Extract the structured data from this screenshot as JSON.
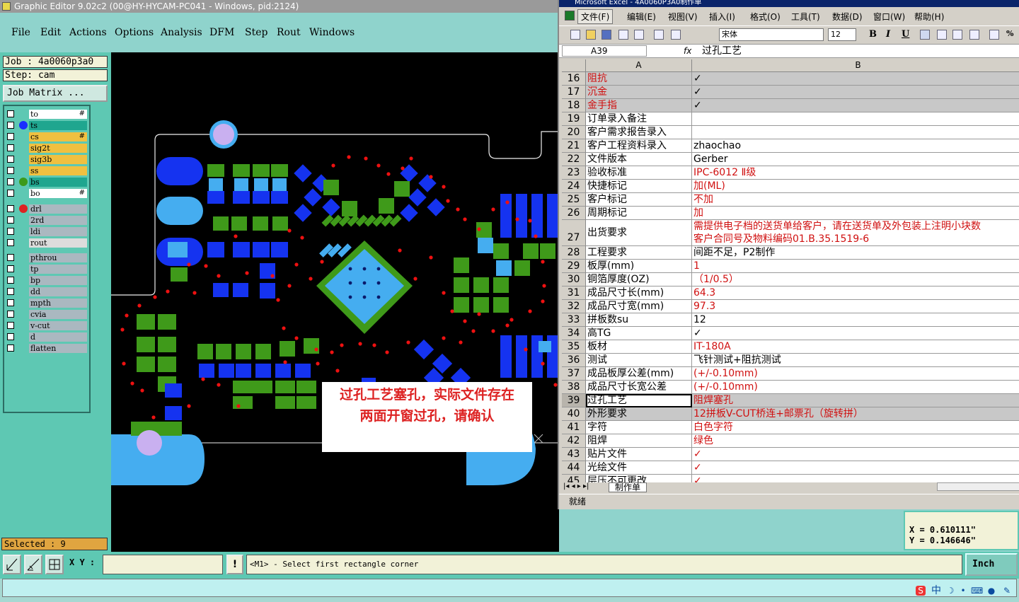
{
  "genesis": {
    "title": "Graphic Editor 9.02c2 (00@HY-HYCAM-PC041 - Windows, pid:2124)",
    "menu": [
      "File",
      "Edit",
      "Actions",
      "Options",
      "Analysis",
      "DFM",
      "Step",
      "Rout",
      "Windows"
    ],
    "job": "Job : 4a0060p3a0",
    "step": "Step: cam",
    "job_matrix": "Job Matrix ...",
    "layers": [
      {
        "name": "to",
        "color": "#ffffff",
        "dot": "",
        "mark": "#"
      },
      {
        "name": "ts",
        "color": "#1fa68f",
        "dot": "#1a2cff",
        "mark": ""
      },
      {
        "name": "cs",
        "color": "#f0c040",
        "dot": "",
        "mark": "#"
      },
      {
        "name": "sig2t",
        "color": "#f0c040",
        "dot": "",
        "mark": ""
      },
      {
        "name": "sig3b",
        "color": "#f0c040",
        "dot": "",
        "mark": ""
      },
      {
        "name": "ss",
        "color": "#f0c040",
        "dot": "",
        "mark": ""
      },
      {
        "name": "bs",
        "color": "#1fa68f",
        "dot": "#3c9a1a",
        "mark": ""
      },
      {
        "name": "bo",
        "color": "#ffffff",
        "dot": "",
        "mark": "#"
      },
      {
        "name": "drl",
        "color": "#aab8c0",
        "dot": "#d22",
        "mark": ""
      },
      {
        "name": "2rd",
        "color": "#aab8c0",
        "dot": "",
        "mark": ""
      },
      {
        "name": "ldi",
        "color": "#aab8c0",
        "dot": "",
        "mark": ""
      },
      {
        "name": "rout",
        "color": "#dcdcdc",
        "dot": "",
        "mark": ""
      },
      {
        "name": "pthrou",
        "color": "#aab8c0",
        "dot": "",
        "mark": ""
      },
      {
        "name": "tp",
        "color": "#aab8c0",
        "dot": "",
        "mark": ""
      },
      {
        "name": "bp",
        "color": "#aab8c0",
        "dot": "",
        "mark": ""
      },
      {
        "name": "dd",
        "color": "#aab8c0",
        "dot": "",
        "mark": ""
      },
      {
        "name": "mpth",
        "color": "#aab8c0",
        "dot": "",
        "mark": ""
      },
      {
        "name": "cvia",
        "color": "#aab8c0",
        "dot": "",
        "mark": ""
      },
      {
        "name": "v-cut",
        "color": "#aab8c0",
        "dot": "",
        "mark": ""
      },
      {
        "name": "d",
        "color": "#aab8c0",
        "dot": "",
        "mark": ""
      },
      {
        "name": "flatten",
        "color": "#aab8c0",
        "dot": "",
        "mark": ""
      }
    ],
    "selected": "Selected : 9",
    "xy_label": "X Y :",
    "xy_value": "",
    "bang": "!",
    "prompt": "<M1> - Select first rectangle corner",
    "units": "Inch",
    "coord_x": "X  = 0.610111\"",
    "coord_y": "Y  = 0.146646\"",
    "annotation_line1": "过孔工艺塞孔，实际文件存在",
    "annotation_line2": "两面开窗过孔，请确认"
  },
  "excel": {
    "title": "Microsoft Excel - 4A0060P3A0制作单",
    "menu": [
      "文件(F)",
      "编辑(E)",
      "视图(V)",
      "插入(I)",
      "格式(O)",
      "工具(T)",
      "数据(D)",
      "窗口(W)",
      "帮助(H)"
    ],
    "font_name": "宋体",
    "font_size": "12",
    "name_box": "A39",
    "fx": "fx",
    "formula_value": "过孔工艺",
    "col_a": "A",
    "col_b": "B",
    "rows": [
      {
        "n": "16",
        "a": "阻抗",
        "b": "✓",
        "red_a": true,
        "red_b": false,
        "gray": true
      },
      {
        "n": "17",
        "a": "沉金",
        "b": "✓",
        "red_a": true,
        "red_b": false,
        "gray": true
      },
      {
        "n": "18",
        "a": "金手指",
        "b": "✓",
        "red_a": true,
        "red_b": false,
        "gray": true
      },
      {
        "n": "19",
        "a": "订单录入备注",
        "b": "",
        "red_a": false,
        "red_b": false,
        "gray": false
      },
      {
        "n": "20",
        "a": "客户需求报告录入",
        "b": "",
        "red_a": false,
        "red_b": false,
        "gray": false
      },
      {
        "n": "21",
        "a": "客户工程资料录入",
        "b": "zhaochao",
        "red_a": false,
        "red_b": false,
        "gray": false
      },
      {
        "n": "22",
        "a": "文件版本",
        "b": "Gerber",
        "red_a": false,
        "red_b": false,
        "gray": false
      },
      {
        "n": "23",
        "a": "验收标准",
        "b": "IPC-6012 Ⅱ级",
        "red_a": false,
        "red_b": true,
        "gray": false
      },
      {
        "n": "24",
        "a": "快捷标记",
        "b": "加(ML)",
        "red_a": false,
        "red_b": true,
        "gray": false
      },
      {
        "n": "25",
        "a": "客户标记",
        "b": "不加",
        "red_a": false,
        "red_b": true,
        "gray": false
      },
      {
        "n": "26",
        "a": "周期标记",
        "b": "加",
        "red_a": false,
        "red_b": true,
        "gray": false
      },
      {
        "n": "27",
        "a": "出货要求",
        "b": "需提供电子档的送货单给客户，请在送货单及外包装上注明小块数",
        "b2": "客户合同号及物料编码01.B.35.1519-6",
        "red_a": false,
        "red_b": true,
        "gray": false,
        "tall": true
      },
      {
        "n": "28",
        "a": "工程要求",
        "b": "间距不足，P2制作",
        "red_a": false,
        "red_b": false,
        "gray": false
      },
      {
        "n": "29",
        "a": "板厚(mm)",
        "b": "1",
        "red_a": false,
        "red_b": true,
        "gray": false
      },
      {
        "n": "30",
        "a": "铜箔厚度(OZ)",
        "b": "（1/0.5）",
        "red_a": false,
        "red_b": true,
        "gray": false
      },
      {
        "n": "31",
        "a": "成品尺寸长(mm)",
        "b": "64.3",
        "red_a": false,
        "red_b": true,
        "gray": false
      },
      {
        "n": "32",
        "a": "成品尺寸宽(mm)",
        "b": "97.3",
        "red_a": false,
        "red_b": true,
        "gray": false
      },
      {
        "n": "33",
        "a": "拼板数su",
        "b": "12",
        "red_a": false,
        "red_b": false,
        "gray": false
      },
      {
        "n": "34",
        "a": "高TG",
        "b": "✓",
        "red_a": false,
        "red_b": false,
        "gray": false
      },
      {
        "n": "35",
        "a": "板材",
        "b": "IT-180A",
        "red_a": false,
        "red_b": true,
        "gray": false
      },
      {
        "n": "36",
        "a": "测试",
        "b": "飞针测试+阻抗测试",
        "red_a": false,
        "red_b": false,
        "gray": false
      },
      {
        "n": "37",
        "a": "成品板厚公差(mm)",
        "b": "(+/-0.10mm)",
        "red_a": false,
        "red_b": true,
        "gray": false
      },
      {
        "n": "38",
        "a": "成品尺寸长宽公差",
        "b": "(+/-0.10mm)",
        "red_a": false,
        "red_b": true,
        "gray": false
      },
      {
        "n": "39",
        "a": "过孔工艺",
        "b": "阻焊塞孔",
        "red_a": false,
        "red_b": true,
        "gray": true,
        "selected": true
      },
      {
        "n": "40",
        "a": "外形要求",
        "b": "12拼板V-CUT桥连+邮票孔（旋转拼）",
        "red_a": false,
        "red_b": true,
        "gray": true
      },
      {
        "n": "41",
        "a": "字符",
        "b": "白色字符",
        "red_a": false,
        "red_b": true,
        "gray": false
      },
      {
        "n": "42",
        "a": "阻焊",
        "b": "绿色",
        "red_a": false,
        "red_b": true,
        "gray": false
      },
      {
        "n": "43",
        "a": "贴片文件",
        "b": "✓",
        "red_a": false,
        "red_b": true,
        "gray": false
      },
      {
        "n": "44",
        "a": "光绘文件",
        "b": "✓",
        "red_a": false,
        "red_b": true,
        "gray": false
      },
      {
        "n": "45",
        "a": "层压不可更改",
        "b": "✓",
        "red_a": false,
        "red_b": true,
        "gray": false
      }
    ],
    "sheet_tab": "制作单",
    "status": "就绪"
  },
  "tray": {
    "ime": "中"
  }
}
